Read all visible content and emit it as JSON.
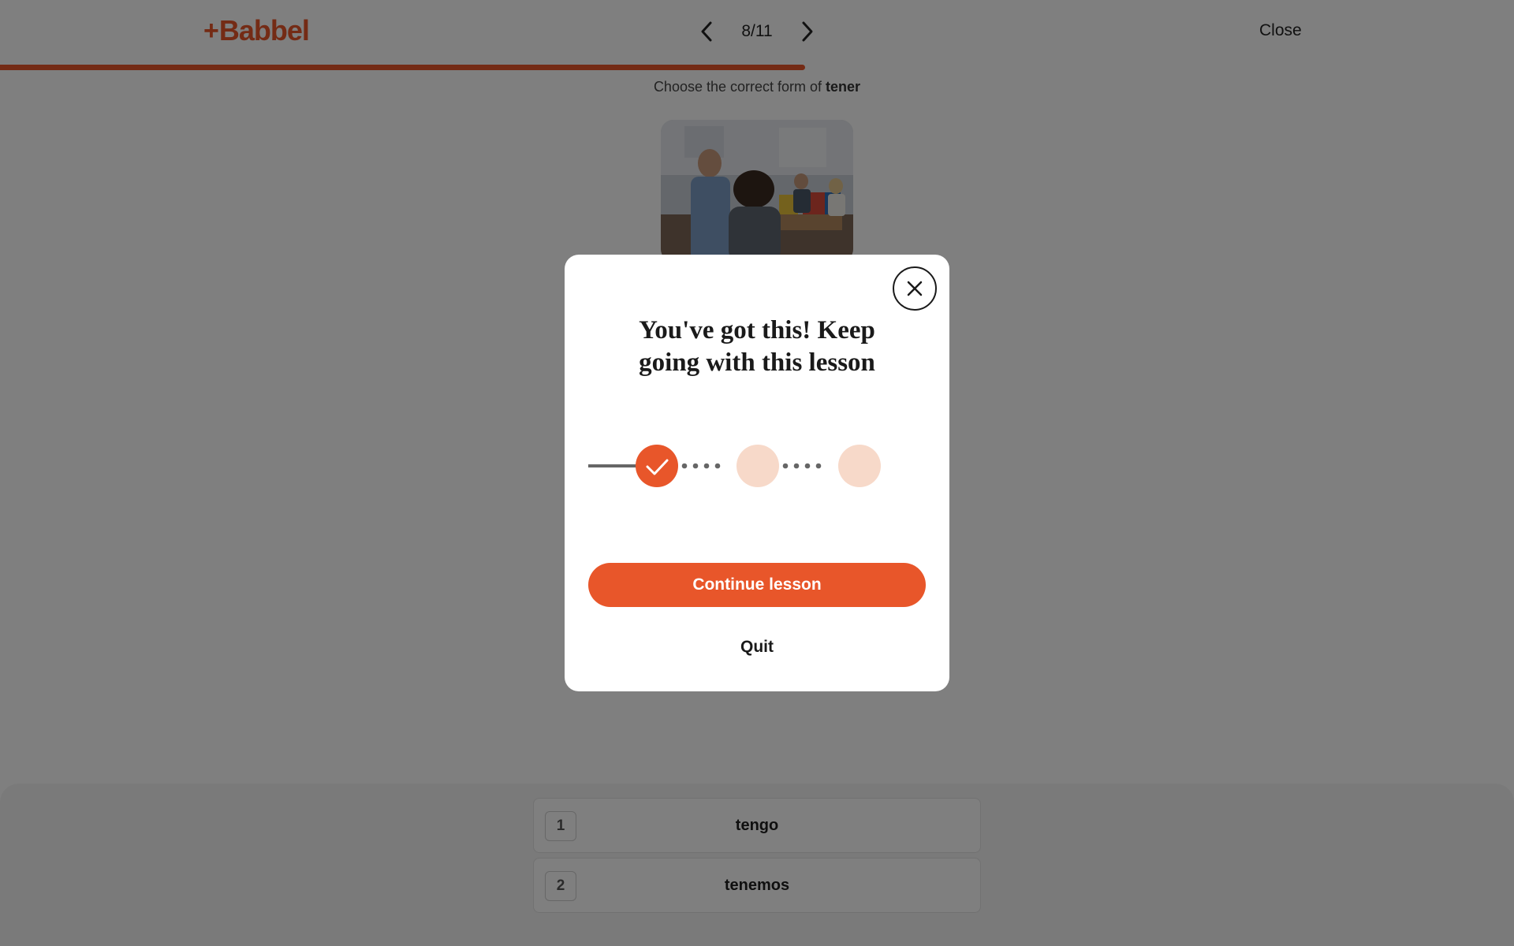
{
  "header": {
    "logo_plus": "+",
    "logo_text": "Babbel",
    "page_indicator": "8/11",
    "prev_icon": "chevron-left-icon",
    "next_icon": "chevron-right-icon",
    "close_label": "Close"
  },
  "progress": {
    "fraction": 0.532,
    "color": "#e8562a"
  },
  "lesson": {
    "instruction_prefix": "Choose the correct form of",
    "instruction_word": "tener",
    "image": "office-scene-photo"
  },
  "answers": [
    {
      "key": "1",
      "text": "tengo"
    },
    {
      "key": "2",
      "text": "tenemos"
    }
  ],
  "modal": {
    "title_line1": "You've got this! Keep",
    "title_line2": "going with this lesson",
    "close_icon": "close-icon",
    "steps": [
      {
        "state": "completed",
        "icon": "check-icon"
      },
      {
        "state": "upcoming"
      },
      {
        "state": "upcoming"
      }
    ],
    "continue_label": "Continue lesson",
    "quit_label": "Quit"
  },
  "colors": {
    "accent": "#e8562a",
    "step_pending": "#f7d9c9",
    "overlay": "rgba(0,0,0,0.5)"
  }
}
